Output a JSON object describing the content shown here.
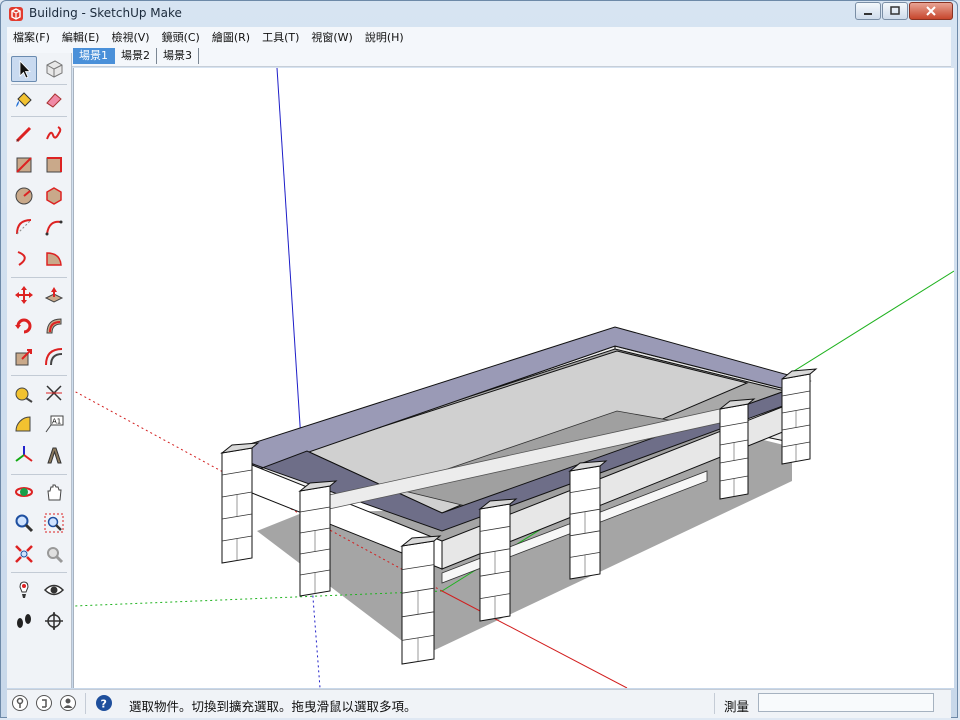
{
  "window": {
    "title": "Building - SketchUp Make"
  },
  "menu": {
    "items": [
      "檔案(F)",
      "編輯(E)",
      "檢視(V)",
      "鏡頭(C)",
      "繪圖(R)",
      "工具(T)",
      "視窗(W)",
      "說明(H)"
    ]
  },
  "scenes": {
    "tabs": [
      "場景1",
      "場景2",
      "場景3"
    ],
    "active": "場景1"
  },
  "toolbar": {
    "tools": [
      "select",
      "make-component",
      "paint-bucket",
      "eraser",
      "line",
      "freehand",
      "rectangle",
      "rotated-rectangle",
      "circle",
      "polygon",
      "arc",
      "two-point-arc",
      "three-point-arc",
      "pie",
      "move",
      "push-pull",
      "rotate",
      "follow-me",
      "scale",
      "offset",
      "tape-measure",
      "dimension",
      "protractor",
      "text",
      "axes",
      "3d-text",
      "orbit",
      "pan",
      "zoom",
      "zoom-window",
      "zoom-extents",
      "previous",
      "position-camera",
      "look-around",
      "walk",
      "section-plane"
    ],
    "selected": "select"
  },
  "status": {
    "message": "選取物件。切換到擴充選取。拖曳滑鼠以選取多項。",
    "measure_label": "測量",
    "measure_value": ""
  },
  "colors": {
    "axis_red": "#d21e1e",
    "axis_green": "#1fb21f",
    "axis_blue": "#1e1ec8",
    "face_front": "#ffffff",
    "face_back": "#9a9ab6",
    "ground_shadow": "#a5a5a5"
  }
}
